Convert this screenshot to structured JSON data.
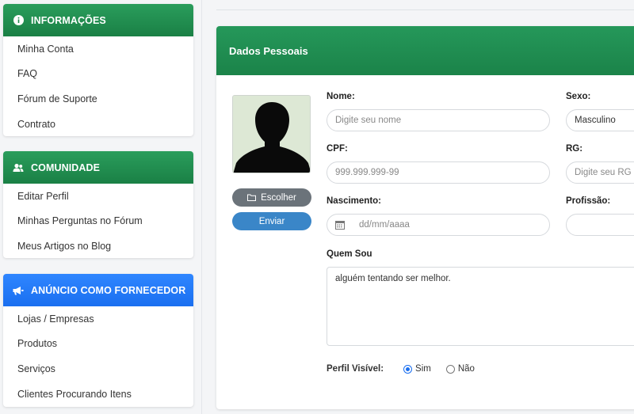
{
  "sidebar": {
    "sections": [
      {
        "title": "INFORMAÇÕES",
        "icon": "info-icon",
        "color": "#1e8a4c",
        "items": [
          "Minha Conta",
          "FAQ",
          "Fórum de Suporte",
          "Contrato"
        ]
      },
      {
        "title": "COMUNIDADE",
        "icon": "users-icon",
        "color": "#1e8a4c",
        "items": [
          "Editar Perfil",
          "Minhas Perguntas no Fórum",
          "Meus Artigos no Blog"
        ]
      },
      {
        "title": "ANÚNCIO COMO FORNECEDOR",
        "icon": "megaphone-icon",
        "color": "#1a6ff0",
        "items": [
          "Lojas / Empresas",
          "Produtos",
          "Serviços",
          "Clientes Procurando Itens"
        ]
      }
    ]
  },
  "form": {
    "header": "Dados Pessoais",
    "choose_label": "Escolher",
    "send_label": "Enviar",
    "name": {
      "label": "Nome:",
      "placeholder": "Digite seu nome"
    },
    "sex": {
      "label": "Sexo:",
      "value": "Masculino"
    },
    "cpf": {
      "label": "CPF:",
      "placeholder": "999.999.999-99"
    },
    "rg": {
      "label": "RG:",
      "placeholder": "Digite seu RG"
    },
    "birth": {
      "label": "Nascimento:",
      "placeholder": "dd/mm/aaaa"
    },
    "profession": {
      "label": "Profissão:",
      "value": ""
    },
    "about": {
      "label": "Quem Sou",
      "value": "alguém tentando ser melhor."
    },
    "visible": {
      "label": "Perfil Visível:",
      "yes": "Sim",
      "no": "Não",
      "selected": "Sim"
    }
  }
}
